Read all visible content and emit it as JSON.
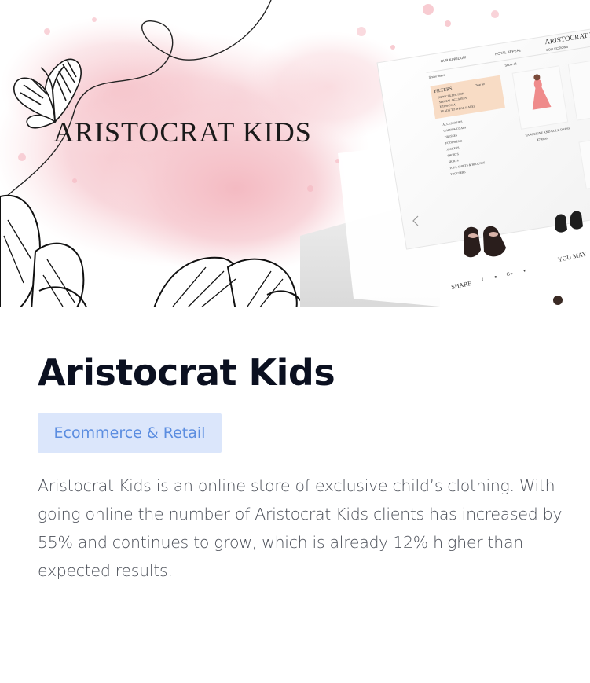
{
  "hero": {
    "logo_text": "ARISTOCRAT KIDS",
    "mockup": {
      "brand": "ARISTOCRAT KIDS",
      "header_left": "OUR KINGDOM",
      "header_right": "ROYAL APPEAL",
      "header_far": "COLLECTIONS",
      "back_link": "Show filters",
      "sort_label": "Show all",
      "filters_title": "FILTERS",
      "clear_label": "Clear all",
      "filter_options": [
        "NEW COLLECTION",
        "SPECIAL OCCASION",
        "EID SPECIAL",
        "READY TO WEAR (SALE)"
      ],
      "categories": [
        "ACCESSORIES",
        "CAPES & COATS",
        "DRESSES",
        "FOOTWEAR",
        "JACKETS",
        "SHORTS",
        "SKIRTS",
        "TOPS, SHIRTS & BLOUSES",
        "TROUSERS"
      ],
      "product_name": "TANGERINE AND GOLD DRESS",
      "product_price": "€749.00",
      "share_label": "SHARE",
      "you_may": "YOU MAY"
    }
  },
  "card": {
    "title": "Aristocrat Kids",
    "tag": "Ecommerce & Retail",
    "description": "Aristocrat Kids is an online store of exclusive child’s clothing. With going online the number of Aristocrat Kids clients has increased by 55% and continues to grow, which is already 12% higher than expected results."
  },
  "colors": {
    "tag_bg": "#dbe6fb",
    "tag_text": "#5b8de0",
    "title": "#0b1020",
    "body_text": "#4b4f58",
    "watercolor": "#f7c9cf"
  }
}
